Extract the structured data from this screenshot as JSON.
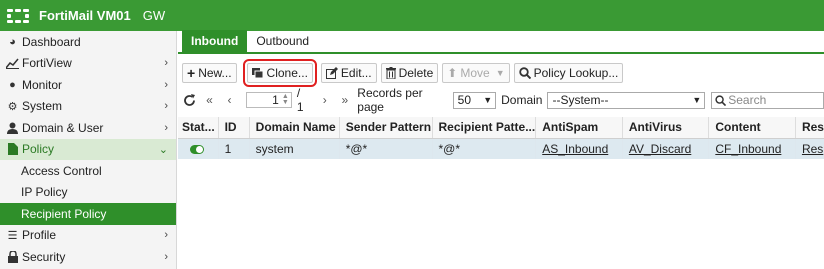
{
  "header": {
    "app_title": "FortiMail VM01",
    "vdom": "GW"
  },
  "sidebar": {
    "items": [
      {
        "label": "Dashboard",
        "icon": "dashboard-icon",
        "chevron": false
      },
      {
        "label": "FortiView",
        "icon": "chart-icon",
        "chevron": true
      },
      {
        "label": "Monitor",
        "icon": "monitor-icon",
        "chevron": true
      },
      {
        "label": "System",
        "icon": "gear-icon",
        "chevron": true
      },
      {
        "label": "Domain & User",
        "icon": "user-icon",
        "chevron": true
      },
      {
        "label": "Policy",
        "icon": "document-icon",
        "chevron": true,
        "expanded": true
      },
      {
        "label": "Profile",
        "icon": "list-icon",
        "chevron": true
      },
      {
        "label": "Security",
        "icon": "lock-icon",
        "chevron": true
      }
    ],
    "policy_children": [
      "Access Control",
      "IP Policy",
      "Recipient Policy"
    ]
  },
  "tabs": [
    "Inbound",
    "Outbound"
  ],
  "toolbar": {
    "new": "New...",
    "clone": "Clone...",
    "edit": "Edit...",
    "delete": "Delete",
    "move": "Move",
    "policy_lookup": "Policy Lookup..."
  },
  "pager": {
    "page": "1",
    "of": "/ 1",
    "records_label": "Records per page",
    "records_value": "50",
    "domain_label": "Domain",
    "domain_value": "--System--",
    "search_placeholder": "Search"
  },
  "table": {
    "columns": [
      "Stat...",
      "ID",
      "Domain Name",
      "Sender Pattern",
      "Recipient Patte...",
      "AntiSpam",
      "AntiVirus",
      "Content",
      "Res"
    ],
    "rows": [
      {
        "status": "enabled",
        "id": "1",
        "domain": "system",
        "sender": "*@*",
        "recipient": "*@*",
        "antispam": "AS_Inbound",
        "antivirus": "AV_Discard",
        "content": "CF_Inbound",
        "res": "Res"
      }
    ]
  },
  "colors": {
    "brand_green": "#3a9a34",
    "selected_row": "#dde9f0",
    "highlight_red": "#e02020"
  }
}
